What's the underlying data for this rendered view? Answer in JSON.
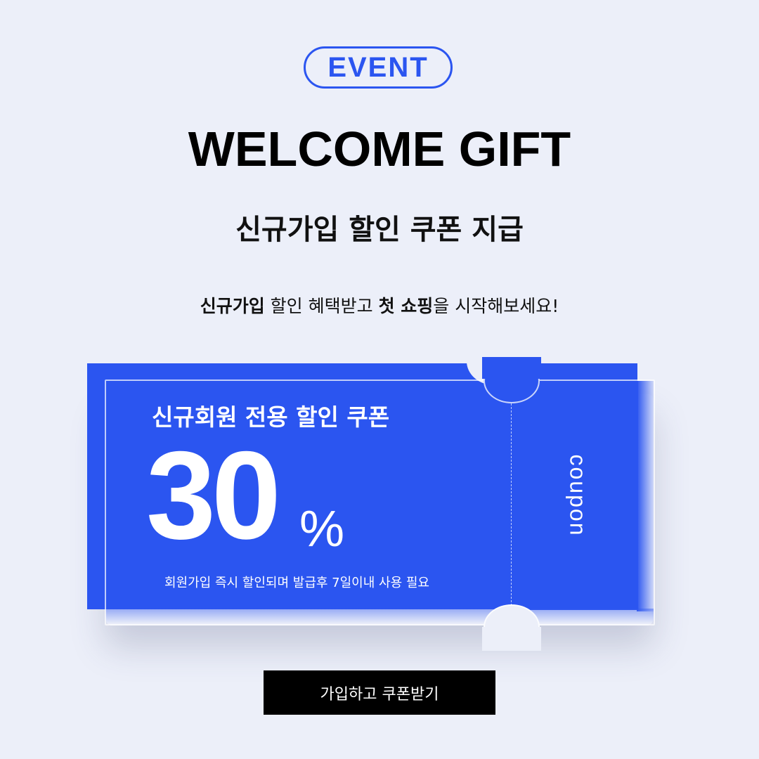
{
  "badge": {
    "label": "EVENT"
  },
  "header": {
    "title": "WELCOME GIFT",
    "subtitle": "신규가입 할인 쿠폰 지급"
  },
  "description": {
    "bold1": "신규가입",
    "text1": " 할인 혜택받고 ",
    "bold2": "첫 쇼핑",
    "text2": "을 시작해보세요!"
  },
  "coupon": {
    "heading": "신규회원 전용 할인 쿠폰",
    "amount": "30",
    "unit": "%",
    "note": "회원가입 즉시 할인되며 발급후 7일이내 사용 필요",
    "stub_label": "coupon",
    "color": "#2b55f0"
  },
  "cta": {
    "label": "가입하고 쿠폰받기"
  },
  "colors": {
    "background": "#eceff9",
    "accent": "#2b55f0",
    "button": "#000000"
  }
}
